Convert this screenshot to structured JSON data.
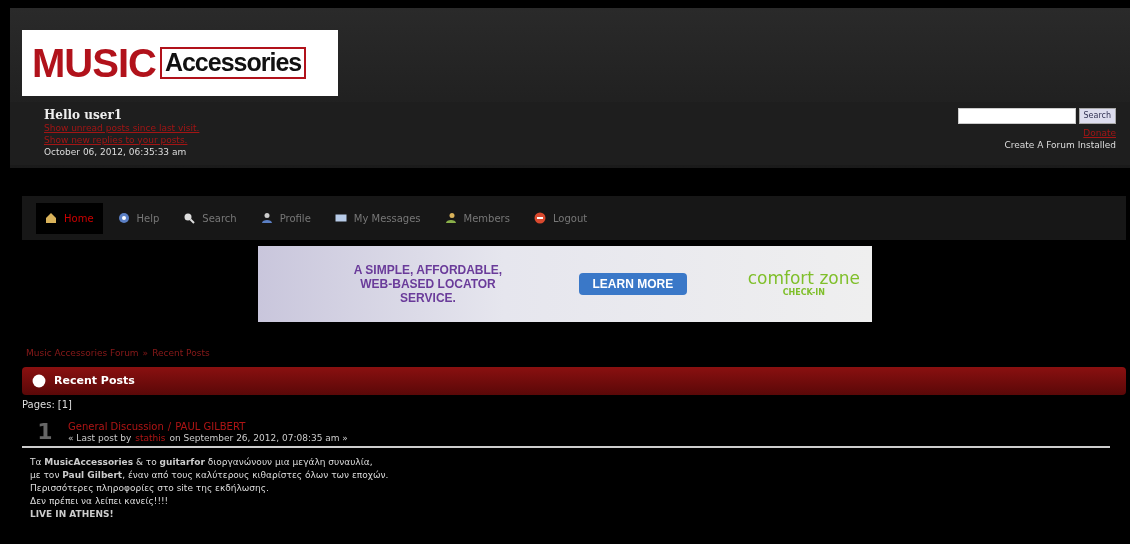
{
  "logo": {
    "part_1": "MUSIC",
    "part_2": "Accessories"
  },
  "user_panel": {
    "greeting": "Hello user1",
    "links": [
      "Show unread posts since last visit.",
      "Show new replies to your posts."
    ],
    "date": "October 06, 2012, 06:35:33 am"
  },
  "search": {
    "button": "Search"
  },
  "right_links": [
    {
      "text": "Donate",
      "kind": "link"
    },
    {
      "text": "Create A Forum Installed",
      "kind": "text"
    }
  ],
  "menu": [
    {
      "label": "Home",
      "selected": true
    },
    {
      "label": "Help",
      "selected": false
    },
    {
      "label": "Search",
      "selected": false
    },
    {
      "label": "Profile",
      "selected": false
    },
    {
      "label": "My Messages",
      "selected": false
    },
    {
      "label": "Members",
      "selected": false
    },
    {
      "label": "Logout",
      "selected": false
    }
  ],
  "banner": {
    "headline": "A SIMPLE, AFFORDABLE, WEB-BASED LOCATOR SERVICE.",
    "button": "LEARN MORE",
    "brand": "comfort zone",
    "brand_sub": "CHECK-IN"
  },
  "breadcrumb": {
    "items": [
      "Music Accessories Forum",
      "Recent Posts"
    ],
    "separator": "»"
  },
  "section_title": "Recent Posts",
  "pages": {
    "label": "Pages:",
    "current": "[1]"
  },
  "posts": [
    {
      "number": "1",
      "board": "General Discussion",
      "slash": "/",
      "subject": "PAUL GILBERT",
      "meta_before": "« Last post by",
      "author": "stathis",
      "meta_after": "on September 26, 2012, 07:08:35 am »",
      "body": [
        "Τα **MusicAccessories** & το **guitarfor** διοργανώνουν μια μεγάλη συναυλία,",
        "με τον **Paul Gilbert**, έναν από τους καλύτερους κιθαρίστες όλων των εποχών.",
        "Περισσότερες πληροφορίες στο site της εκδήλωσης.",
        "Δεν πρέπει να λείπει κανείς!!!!",
        "**LIVE IN ATHENS!**"
      ]
    }
  ]
}
